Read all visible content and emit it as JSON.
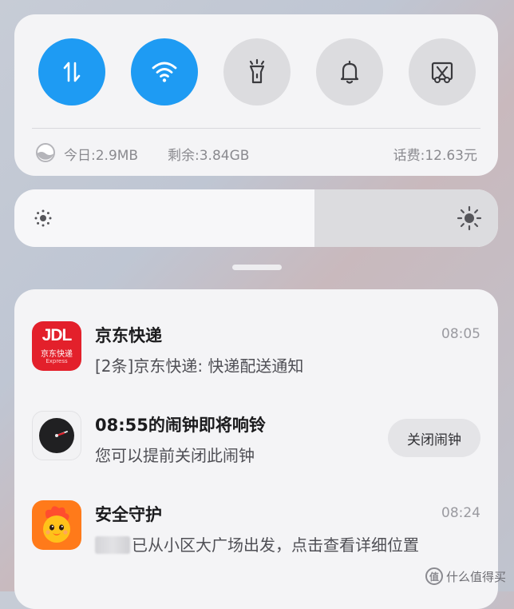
{
  "quick_settings": {
    "toggles": [
      {
        "name": "mobile-data",
        "icon": "data-transfer-icon",
        "on": true
      },
      {
        "name": "wifi",
        "icon": "wifi-icon",
        "on": true
      },
      {
        "name": "flashlight",
        "icon": "flashlight-icon",
        "on": false
      },
      {
        "name": "sound",
        "icon": "bell-icon",
        "on": false
      },
      {
        "name": "screenshot",
        "icon": "scissors-screenshot-icon",
        "on": false
      }
    ],
    "usage_today": "今日:2.9MB",
    "usage_remaining": "剩余:3.84GB",
    "usage_balance": "话费:12.63元"
  },
  "brightness": {
    "level": 0.62
  },
  "colors": {
    "accent": "#1e9bf3",
    "jd_red": "#e3202b",
    "safety_orange": "#ff7a1a"
  },
  "notifications": [
    {
      "app": "京东快递",
      "icon": "jd-express-icon",
      "icon_text": "JDL",
      "icon_sub": "京东快递",
      "icon_sub2": "Express",
      "body": "[2条]京东快递: 快递配送通知",
      "time": "08:05"
    },
    {
      "app": "08:55的闹钟即将响铃",
      "icon": "alarm-clock-icon",
      "body": "您可以提前关闭此闹钟",
      "action": "关闭闹钟"
    },
    {
      "app": "安全守护",
      "icon": "safety-guard-icon",
      "body": "已从小区大广场出发，点击查看详细位置",
      "time": "08:24"
    }
  ],
  "watermark": "什么值得买",
  "watermark_icon": "值"
}
